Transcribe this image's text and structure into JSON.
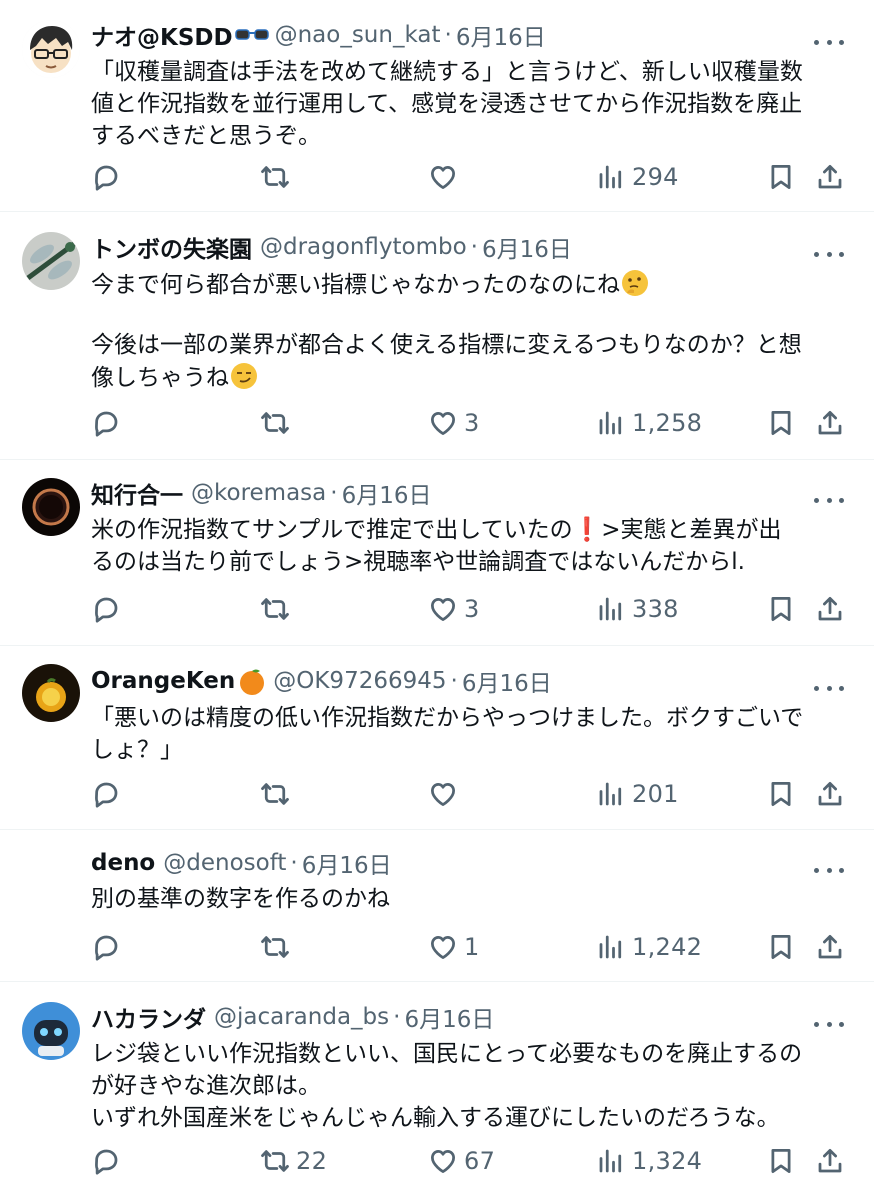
{
  "tweets": [
    {
      "name": "ナオ@KSDD",
      "name_emoji": "glasses-emoji",
      "handle": "@nao_sun_kat",
      "date": "6月16日",
      "lines": [
        "「収穫量調査は手法を改めて継続する」と言うけど、新しい収穫量数",
        "値と作況指数を並行運用して、感覚を浸透させてから作況指数を廃止",
        "するべきだと思うぞ。"
      ],
      "replies": "",
      "retweets": "",
      "likes": "",
      "views": "294"
    },
    {
      "name": "トンボの失楽園",
      "handle": "@dragonflytombo",
      "date": "6月16日",
      "line1": "今まで何ら都合が悪い指標じゃなかったのなのにね",
      "line1_emoji": "thinking-face-emoji",
      "line2": "今後は一部の業界が都合よく使える指標に変えるつもりなのか？と想",
      "line3": "像しちゃうね",
      "line3_emoji": "smirking-face-emoji",
      "replies": "",
      "retweets": "",
      "likes": "3",
      "views": "1,258"
    },
    {
      "name": "知行合一",
      "handle": "@koremasa",
      "date": "6月16日",
      "line1a": "米の作況指数てサンプルで推定で出していたの",
      "line1_mark": "❗",
      "line1b": ">実態と差異が出",
      "line2": "るのは当たり前でしょう>視聴率や世論調査ではないんだからl.",
      "replies": "",
      "retweets": "",
      "likes": "3",
      "views": "338"
    },
    {
      "name": "OrangeKen",
      "name_emoji": "tangerine-emoji",
      "handle": "@OK97266945",
      "date": "6月16日",
      "lines": [
        "「悪いのは精度の低い作況指数だからやっつけました。ボクすごいで",
        "しょ？」"
      ],
      "replies": "",
      "retweets": "",
      "likes": "",
      "views": "201"
    },
    {
      "name": "deno",
      "handle": "@denosoft",
      "date": "6月16日",
      "lines": [
        "別の基準の数字を作るのかね"
      ],
      "replies": "",
      "retweets": "",
      "likes": "1",
      "views": "1,242"
    },
    {
      "name": "ハカランダ",
      "handle": "@jacaranda_bs",
      "date": "6月16日",
      "lines": [
        "レジ袋といい作況指数といい、国民にとって必要なものを廃止するの",
        "が好きやな進次郎は。",
        "いずれ外国産米をじゃんじゃん輸入する運びにしたいのだろうな。"
      ],
      "replies": "",
      "retweets": "22",
      "likes": "67",
      "views": "1,324"
    }
  ],
  "icons": {
    "reply": "reply-icon",
    "retweet": "retweet-icon",
    "like": "heart-icon",
    "views": "views-chart-icon",
    "bookmark": "bookmark-icon",
    "share": "share-icon",
    "more": "more-options-icon"
  },
  "colors": {
    "text": "#0f1419",
    "secondary": "#536471",
    "divider": "#eff3f4"
  }
}
